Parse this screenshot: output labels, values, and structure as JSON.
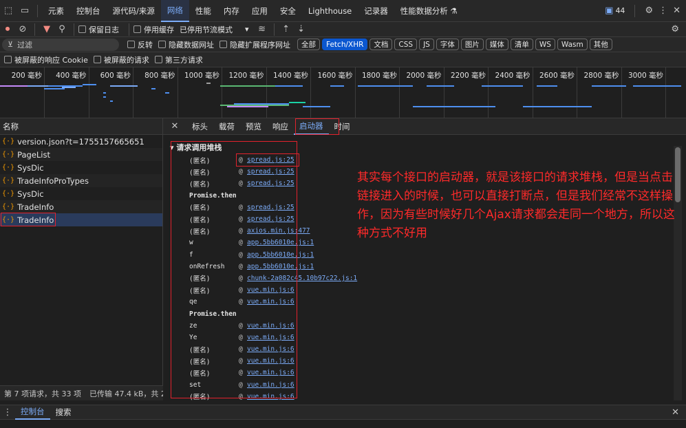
{
  "top_tabs": [
    "元素",
    "控制台",
    "源代码/来源",
    "网络",
    "性能",
    "内存",
    "应用",
    "安全",
    "Lighthouse",
    "记录器",
    "性能数据分析 ⚗"
  ],
  "issues_count": "44",
  "toolbar": {
    "preserve_log": "保留日志",
    "disable_cache": "停用缓存",
    "throttle": "已停用节流模式"
  },
  "filter": {
    "placeholder": "过滤",
    "invert": "反转",
    "hide_data_urls": "隐藏数据网址",
    "hide_ext_urls": "隐藏扩展程序网址",
    "types": [
      "全部",
      "Fetch/XHR",
      "文档",
      "CSS",
      "JS",
      "字体",
      "图片",
      "媒体",
      "清单",
      "WS",
      "Wasm",
      "其他"
    ],
    "active_type": "Fetch/XHR"
  },
  "options": {
    "blocked_cookies": "被屏蔽的响应 Cookie",
    "blocked_requests": "被屏蔽的请求",
    "third_party": "第三方请求"
  },
  "timeline": {
    "ticks": [
      "200 毫秒",
      "400 毫秒",
      "600 毫秒",
      "800 毫秒",
      "1000 毫秒",
      "1200 毫秒",
      "1400 毫秒",
      "1600 毫秒",
      "1800 毫秒",
      "2000 毫秒",
      "2200 毫秒",
      "2400 毫秒",
      "2600 毫秒",
      "2800 毫秒",
      "3000 毫秒"
    ]
  },
  "list": {
    "header": "名称",
    "rows": [
      "version.json?t=1755157665651",
      "PageList",
      "SysDic",
      "TradeInfoProTypes",
      "SysDic",
      "TradeInfo",
      "TradeInfo"
    ],
    "status": "第 7 项请求，共 33 项",
    "transfer": "已传输 47.4 kB，共 2"
  },
  "detail": {
    "tabs": [
      "标头",
      "载荷",
      "预览",
      "响应",
      "启动器",
      "时间"
    ],
    "active_tab": "启动器",
    "section_title": "请求调用堆栈",
    "frames": [
      {
        "fn": "(匿名)",
        "src": "spread.js:25"
      },
      {
        "fn": "(匿名)",
        "src": "spread.js:25"
      },
      {
        "fn": "(匿名)",
        "src": "spread.js:25"
      },
      {
        "fn": "Promise.then",
        "src": ""
      },
      {
        "fn": "(匿名)",
        "src": "spread.js:25"
      },
      {
        "fn": "(匿名)",
        "src": "spread.js:25"
      },
      {
        "fn": "(匿名)",
        "src": "axios.min.js:477"
      },
      {
        "fn": "w",
        "src": "app.5bb6010e.js:1"
      },
      {
        "fn": "f",
        "src": "app.5bb6010e.js:1"
      },
      {
        "fn": "onRefresh",
        "src": "app.5bb6010e.js:1"
      },
      {
        "fn": "(匿名)",
        "src": "chunk-2a082c45.10b97c22.js:1"
      },
      {
        "fn": "(匿名)",
        "src": "vue.min.js:6"
      },
      {
        "fn": "qe",
        "src": "vue.min.js:6"
      },
      {
        "fn": "Promise.then",
        "src": ""
      },
      {
        "fn": "ze",
        "src": "vue.min.js:6"
      },
      {
        "fn": "Ye",
        "src": "vue.min.js:6"
      },
      {
        "fn": "(匿名)",
        "src": "vue.min.js:6"
      },
      {
        "fn": "(匿名)",
        "src": "vue.min.js:6"
      },
      {
        "fn": "(匿名)",
        "src": "vue.min.js:6"
      },
      {
        "fn": "set",
        "src": "vue.min.js:6"
      },
      {
        "fn": "(匿名)",
        "src": "vue.min.js:6"
      }
    ]
  },
  "annotation": "其实每个接口的启动器，就是该接口的请求堆栈，但是当点击链接进入的时候，也可以直接打断点，但是我们经常不这样操作，因为有些时候好几个Ajax请求都会走同一个地方，所以这种方式不好用",
  "drawer": {
    "tabs": [
      "控制台",
      "搜索"
    ],
    "active_tab": "控制台"
  },
  "colors": {
    "accent": "#7cacf8",
    "highlight_red": "#e4222d",
    "annotation_red": "#ff2a2a"
  }
}
